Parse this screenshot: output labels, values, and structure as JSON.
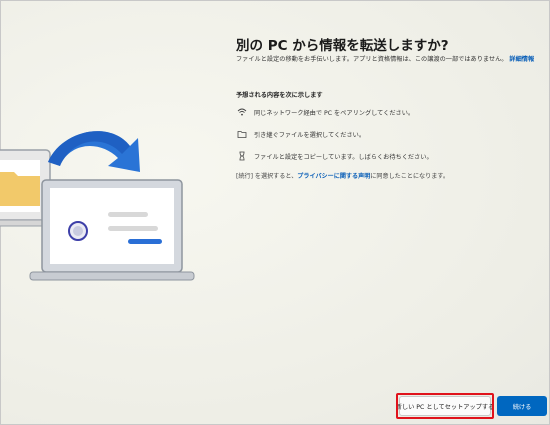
{
  "title": "別の PC から情報を転送しますか?",
  "intro": {
    "text": "ファイルと設定の移動をお手伝いします。アプリと資格情報は、この譲渡の一部ではありません。",
    "link": "詳細情報"
  },
  "expect_heading": "予想される内容を次に示します",
  "steps": [
    {
      "icon": "wifi-icon",
      "text": "同じネットワーク経由で PC をペアリングしてください。"
    },
    {
      "icon": "folder-icon",
      "text": "引き継ぐファイルを選択してください。"
    },
    {
      "icon": "hourglass-icon",
      "text": "ファイルと設定をコピーしています。しばらくお待ちください。"
    }
  ],
  "notice": {
    "before": "[続行] を選択すると、",
    "link": "プライバシーに関する声明",
    "after": "に同意したことになります。"
  },
  "buttons": {
    "setup_new": "新しい PC としてセットアップする",
    "continue": "続ける"
  },
  "colors": {
    "accent": "#0067c0",
    "link": "#0a5fb8",
    "highlight": "#e0121b"
  }
}
